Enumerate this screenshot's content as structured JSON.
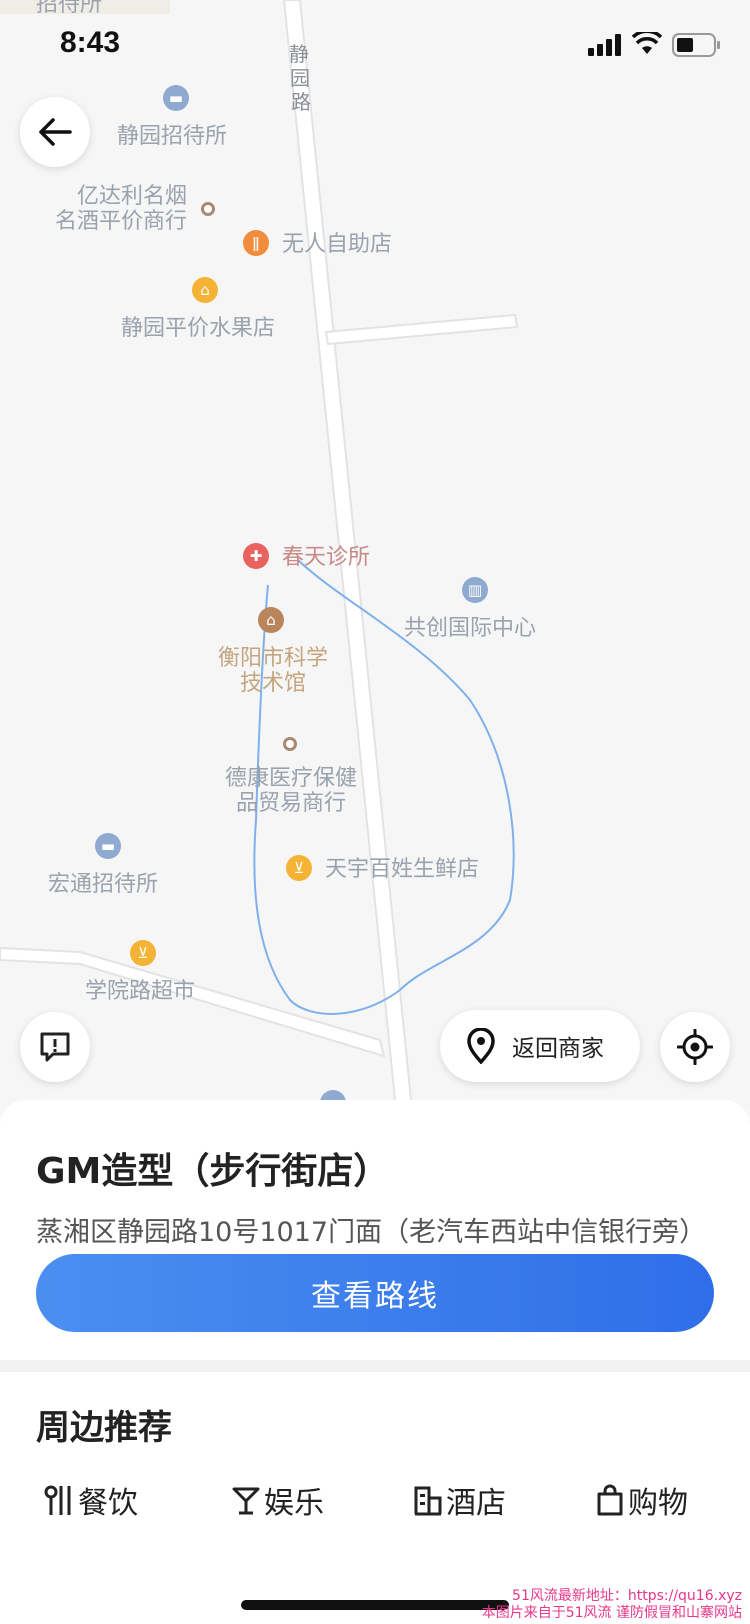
{
  "status_bar": {
    "time": "8:43"
  },
  "map": {
    "road_label_vertical": [
      "静",
      "园",
      "路"
    ],
    "top_partial_label": "招待所",
    "pois": [
      {
        "name": "静园招待所",
        "icon": "hotel-icon",
        "color": "#8faad0"
      },
      {
        "name": "亿达利名烟\n名酒平价商行",
        "icon": "dot-icon",
        "color": "#a88a74"
      },
      {
        "name": "无人自助店",
        "icon": "restaurant-icon",
        "color": "#f08c3c"
      },
      {
        "name": "静园平价水果店",
        "icon": "shop-icon",
        "color": "#f5b335"
      },
      {
        "name": "春天诊所",
        "icon": "clinic-icon",
        "color": "#e8635f"
      },
      {
        "name": "共创国际中心",
        "icon": "building-icon",
        "color": "#8faad0"
      },
      {
        "name": "衡阳市科学\n技术馆",
        "icon": "museum-icon",
        "color": "#b9855c"
      },
      {
        "name": "德康医疗保健\n品贸易商行",
        "icon": "dot-icon",
        "color": "#a88a74"
      },
      {
        "name": "天宇百姓生鲜店",
        "icon": "cart-icon",
        "color": "#f5b335"
      },
      {
        "name": "宏通招待所",
        "icon": "hotel-icon",
        "color": "#8faad0"
      },
      {
        "name": "学院路超市",
        "icon": "cart-icon",
        "color": "#f5b335"
      }
    ],
    "back_merchant_label": "返回商家"
  },
  "shop": {
    "name": "GM造型（步行街店）",
    "address": "蒸湘区静园路10号1017门面（老汽车西站中信银行旁）",
    "route_button": "查看路线"
  },
  "nearby": {
    "title": "周边推荐",
    "categories": [
      "餐饮",
      "娱乐",
      "酒店",
      "购物"
    ]
  },
  "watermark": {
    "line1": "51风流最新地址：https://qu16.xyz",
    "line2": "本图片来自于51风流 谨防假冒和山寨网站"
  }
}
